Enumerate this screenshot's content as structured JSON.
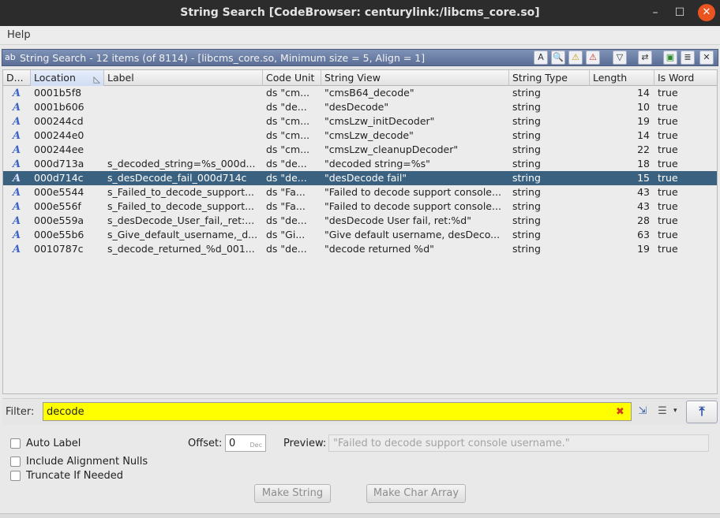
{
  "window": {
    "title": "String Search [CodeBrowser: centurylink:/libcms_core.so]",
    "min": "–",
    "max": "☐",
    "close": "✕"
  },
  "menu": {
    "help": "Help"
  },
  "panel": {
    "title": "String Search - 12 items (of 8114) - [libcms_core.so, Minimum size = 5, Align = 1]"
  },
  "toolbar_icons": [
    "A",
    "🔍",
    "⚠",
    "⚠",
    "▽",
    "⇄",
    "▣",
    "≣",
    "✕"
  ],
  "table": {
    "columns": [
      "D...",
      "Location",
      "Label",
      "Code Unit",
      "String View",
      "String Type",
      "Length",
      "Is Word"
    ],
    "sorted_column": "Location",
    "selected_row": 6,
    "rows": [
      {
        "icon": "A",
        "location": "0001b5f8",
        "label": "",
        "code_unit": "ds  \"cm...",
        "string_view": "\"cmsB64_decode\"",
        "string_type": "string",
        "length": "14",
        "is_word": "true"
      },
      {
        "icon": "A",
        "location": "0001b606",
        "label": "",
        "code_unit": "ds  \"de...",
        "string_view": "\"desDecode\"",
        "string_type": "string",
        "length": "10",
        "is_word": "true"
      },
      {
        "icon": "A",
        "location": "000244cd",
        "label": "",
        "code_unit": "ds  \"cm...",
        "string_view": "\"cmsLzw_initDecoder\"",
        "string_type": "string",
        "length": "19",
        "is_word": "true"
      },
      {
        "icon": "A",
        "location": "000244e0",
        "label": "",
        "code_unit": "ds  \"cm...",
        "string_view": "\"cmsLzw_decode\"",
        "string_type": "string",
        "length": "14",
        "is_word": "true"
      },
      {
        "icon": "A",
        "location": "000244ee",
        "label": "",
        "code_unit": "ds  \"cm...",
        "string_view": "\"cmsLzw_cleanupDecoder\"",
        "string_type": "string",
        "length": "22",
        "is_word": "true"
      },
      {
        "icon": "A",
        "location": "000d713a",
        "label": "s_decoded_string=%s_000d...",
        "code_unit": "ds  \"de...",
        "string_view": "\"decoded string=%s\"",
        "string_type": "string",
        "length": "18",
        "is_word": "true"
      },
      {
        "icon": "A",
        "location": "000d714c",
        "label": "s_desDecode_fail_000d714c",
        "code_unit": "ds  \"de...",
        "string_view": "\"desDecode fail\"",
        "string_type": "string",
        "length": "15",
        "is_word": "true"
      },
      {
        "icon": "A",
        "location": "000e5544",
        "label": "s_Failed_to_decode_support...",
        "code_unit": "ds  \"Fa...",
        "string_view": "\"Failed to decode support console...",
        "string_type": "string",
        "length": "43",
        "is_word": "true"
      },
      {
        "icon": "A",
        "location": "000e556f",
        "label": "s_Failed_to_decode_support...",
        "code_unit": "ds  \"Fa...",
        "string_view": "\"Failed to decode support console...",
        "string_type": "string",
        "length": "43",
        "is_word": "true"
      },
      {
        "icon": "A",
        "location": "000e559a",
        "label": "s_desDecode_User_fail,_ret:...",
        "code_unit": "ds  \"de...",
        "string_view": "\"desDecode User fail, ret:%d\"",
        "string_type": "string",
        "length": "28",
        "is_word": "true"
      },
      {
        "icon": "A",
        "location": "000e55b6",
        "label": "s_Give_default_username,_d...",
        "code_unit": "ds  \"Gi...",
        "string_view": "\"Give default username, desDeco...",
        "string_type": "string",
        "length": "63",
        "is_word": "true"
      },
      {
        "icon": "A",
        "location": "0010787c",
        "label": "s_decode_returned_%d_001...",
        "code_unit": "ds  \"de...",
        "string_view": "\"decode returned %d\"",
        "string_type": "string",
        "length": "19",
        "is_word": "true"
      }
    ]
  },
  "filter": {
    "label": "Filter:",
    "value": "decode",
    "clear": "✖",
    "btn1": "⇲",
    "btn2": "☰",
    "dropdown": "▾",
    "top": "⤒"
  },
  "options": {
    "auto_label": "Auto Label",
    "include_nulls": "Include Alignment Nulls",
    "truncate": "Truncate If Needed",
    "offset_label": "Offset:",
    "offset_value": "0",
    "offset_unit": "Dec",
    "preview_label": "Preview:",
    "preview_value": "\"Failed to decode support console username.\"",
    "make_string": "Make String",
    "make_char_array": "Make Char Array"
  },
  "colors": {
    "selection": "#3a617f",
    "filter_bg": "#ffff00",
    "panel_header": "#5b6e96",
    "close_button": "#e95420"
  }
}
